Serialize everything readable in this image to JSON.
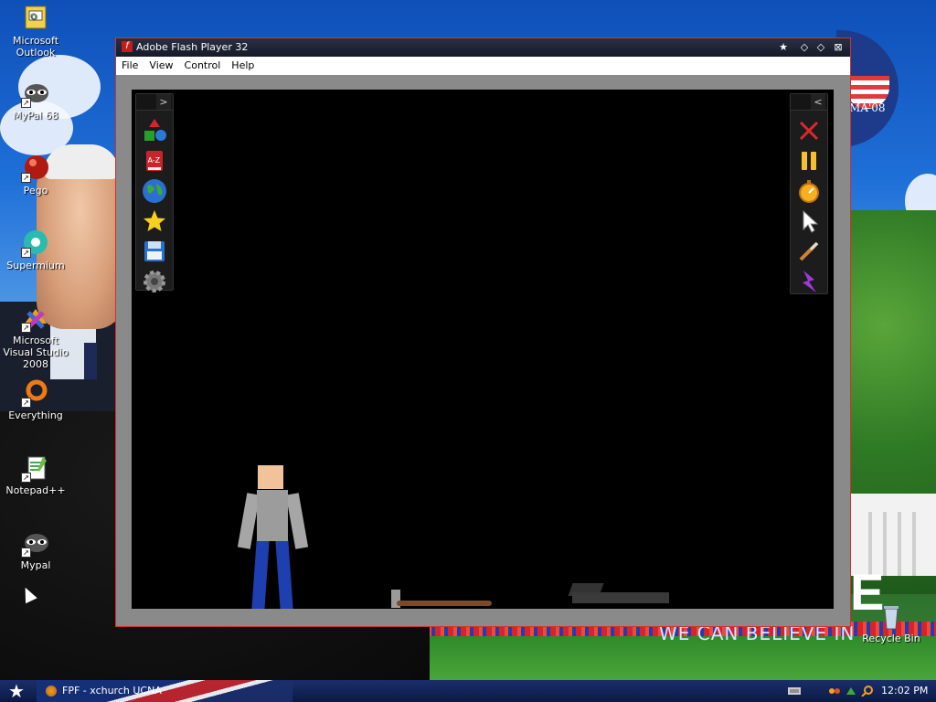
{
  "desktop": {
    "icons": [
      {
        "label": "Microsoft Outlook",
        "icon": "outlook-icon"
      },
      {
        "label": "MyPal 68",
        "icon": "raccoon-icon"
      },
      {
        "label": "Pego",
        "icon": "red-ball-icon"
      },
      {
        "label": "Supermium",
        "icon": "supermium-icon"
      },
      {
        "label": "Microsoft Visual Studio 2008",
        "icon": "visual-studio-icon"
      },
      {
        "label": "Everything",
        "icon": "magnifier-ring-icon"
      },
      {
        "label": "Notepad++",
        "icon": "notepad-icon"
      },
      {
        "label": "Mypal",
        "icon": "raccoon-icon"
      },
      {
        "label": "Recycle Bin",
        "icon": "recycle-bin-icon"
      }
    ],
    "wallpaper": {
      "slogan": "WE CAN BELIEVE IN",
      "logo_text": "MA'08",
      "big_letter": "E"
    }
  },
  "window": {
    "title": "Adobe Flash Player 32",
    "title_icon": "f",
    "buttons": [
      "pin-icon",
      "minimize-icon",
      "maximize-icon",
      "close-icon"
    ],
    "menu": [
      "File",
      "View",
      "Control",
      "Help"
    ]
  },
  "game": {
    "left_panel": {
      "toggle": ">",
      "tools": [
        "shapes-icon",
        "a-z-icon",
        "globe-icon",
        "star-icon",
        "save-icon",
        "gear-icon"
      ]
    },
    "right_panel": {
      "toggle": "<",
      "tools": [
        "delete-icon",
        "pause-icon",
        "stopwatch-icon",
        "pointer-icon",
        "knife-icon",
        "lightning-icon"
      ]
    },
    "objects": [
      "ragdoll-figure",
      "bat",
      "rifle"
    ]
  },
  "taskbar": {
    "start_icon": "star-icon",
    "task_label": "FPF - xchurch UCNA",
    "clock": "12:02 PM",
    "tray_icons": [
      "keyboard-icon",
      "network-icon",
      "update-icon",
      "search-icon"
    ]
  },
  "colors": {
    "stage_bg": "#000000",
    "window_frame": "#8a8a8a",
    "titlebar": "#161a28",
    "taskbar": "#0b1a44",
    "ragdoll_shirt": "#9c9c9c",
    "ragdoll_pants": "#1d3fb0",
    "ragdoll_skin": "#f2c29a"
  }
}
